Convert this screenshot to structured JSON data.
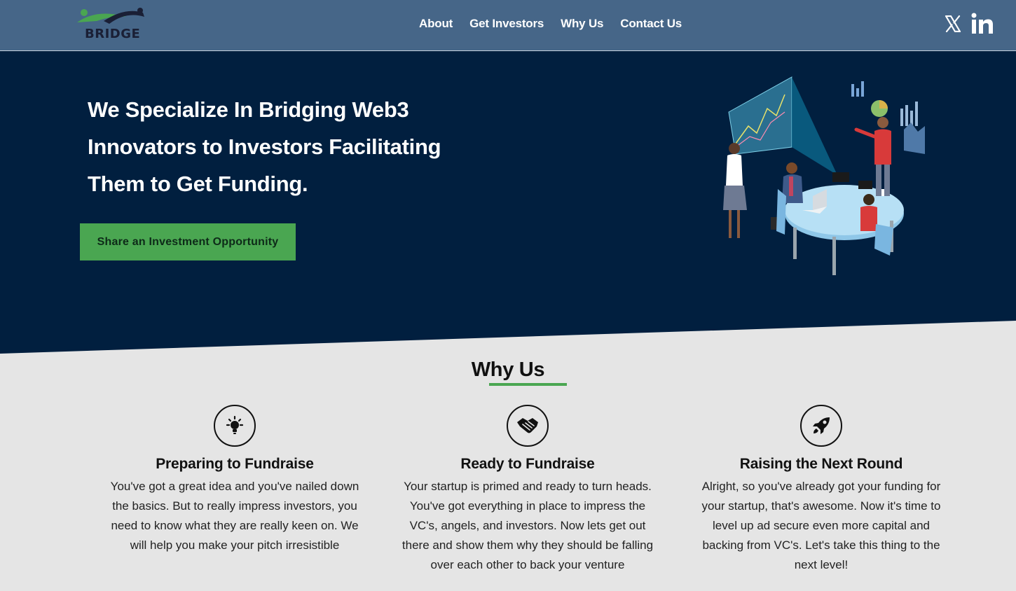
{
  "brand": {
    "name": "BRIDGE",
    "colors": {
      "primary": "#466688",
      "hero_bg": "#011f3f",
      "accent": "#4aa651"
    }
  },
  "nav": {
    "links": [
      {
        "label": "About"
      },
      {
        "label": "Get Investors"
      },
      {
        "label": "Why Us"
      },
      {
        "label": "Contact Us"
      }
    ],
    "social": [
      {
        "icon": "x-twitter-icon"
      },
      {
        "icon": "linkedin-icon"
      }
    ]
  },
  "hero": {
    "title": "We Specialize In Bridging Web3 Innovators to Investors Facilitating Them to Get Funding.",
    "cta_label": "Share an Investment Opportunity"
  },
  "why_us": {
    "title": "Why Us",
    "cards": [
      {
        "icon": "lightbulb-icon",
        "title": "Preparing to Fundraise",
        "text": "You've got a great idea and you've nailed down the basics. But to really impress investors, you need to know what they are really keen on. We will help you make your pitch irresistible"
      },
      {
        "icon": "handshake-icon",
        "title": "Ready to Fundraise",
        "text": "Your startup is primed and ready to turn heads. You've got everything in place to impress the VC's, angels, and investors. Now lets get out there and show them why they should be falling over each other to back your venture"
      },
      {
        "icon": "rocket-icon",
        "title": "Raising the Next Round",
        "text": "Alright, so you've already got your funding for your startup, that's awesome. Now it's time to level up ad secure even more capital and backing from VC's. Let's take this thing to the next level!"
      }
    ]
  }
}
